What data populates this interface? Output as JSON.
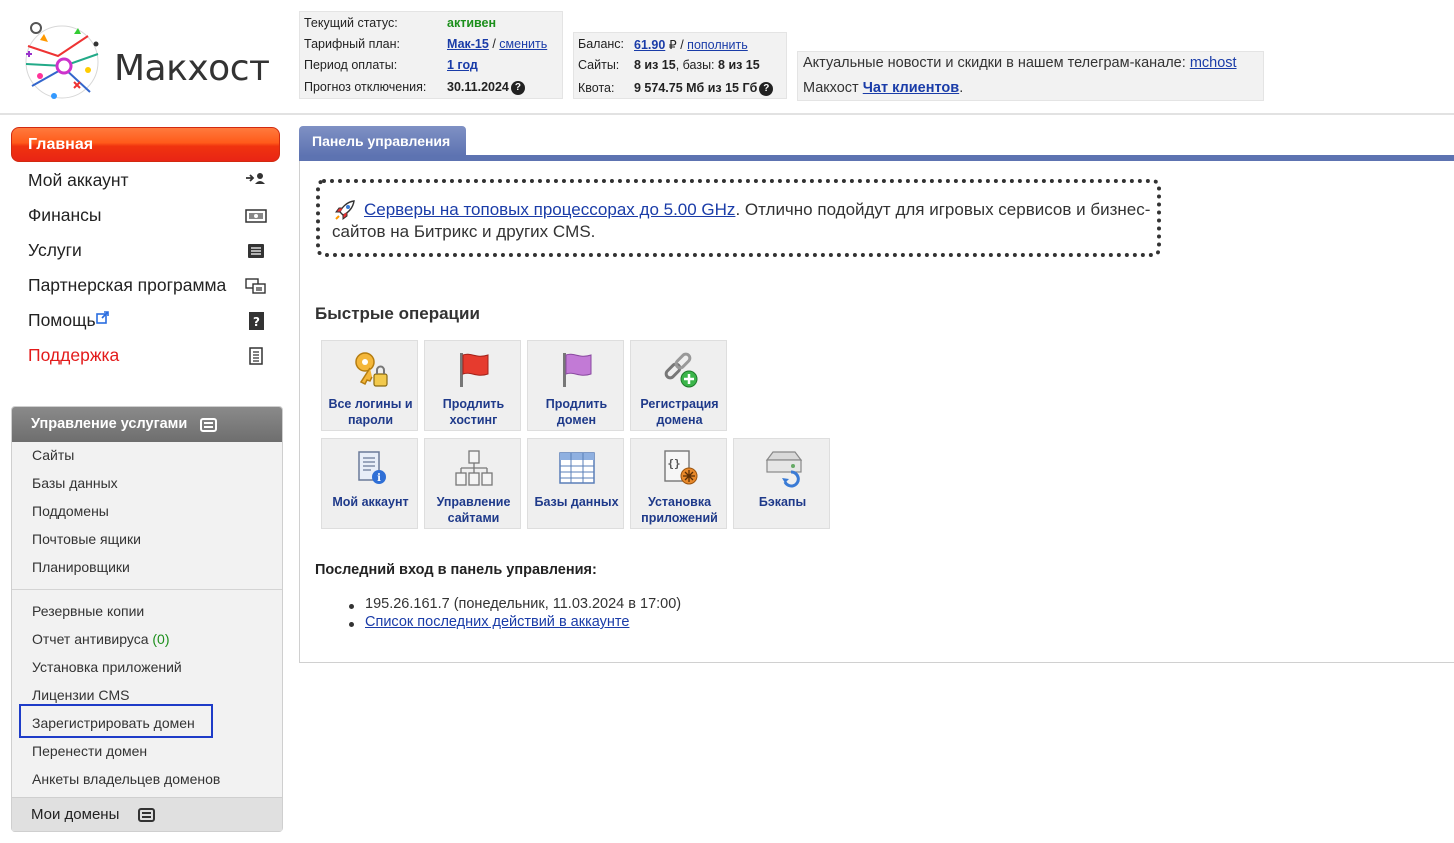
{
  "brand": {
    "name": "Макхост"
  },
  "status": {
    "current_status_label": "Текущий статус:",
    "current_status_value": "активен",
    "plan_label": "Тарифный план:",
    "plan_value": "Мак-15",
    "plan_sep": "/",
    "plan_change": "сменить",
    "period_label": "Период оплаты:",
    "period_value": "1 год",
    "forecast_label": "Прогноз отключения:",
    "forecast_value": "30.11.2024"
  },
  "account": {
    "balance_label": "Баланс:",
    "balance_value": "61.90",
    "currency": "₽",
    "balance_sep": "/",
    "topup": "пополнить",
    "sites_label": "Сайты:",
    "sites_value": "8 из 15",
    "db_label": ", базы:",
    "db_value": "8 из 15",
    "quota_label": "Квота:",
    "quota_value": "9 574.75 Мб из 15 Гб"
  },
  "news": {
    "line1": "Актуальные новости и скидки в нашем телеграм-канале:",
    "telegram": "mchost",
    "line2_prefix": "Макхост",
    "chat": "Чат клиентов",
    "line2_suffix": "."
  },
  "nav": {
    "main": "Главная",
    "items": [
      {
        "label": "Мой аккаунт",
        "icon": "user-switch-icon"
      },
      {
        "label": "Финансы",
        "icon": "money-icon"
      },
      {
        "label": "Услуги",
        "icon": "list-icon"
      },
      {
        "label": "Партнерская программа",
        "icon": "partner-icon"
      },
      {
        "label": "Помощь",
        "icon": "help-book-icon"
      },
      {
        "label": "Поддержка",
        "icon": "support-icon"
      }
    ]
  },
  "services": {
    "title": "Управление услугами",
    "group1": [
      "Сайты",
      "Базы данных",
      "Поддомены",
      "Почтовые ящики",
      "Планировщики"
    ],
    "group2": [
      "Резервные копии",
      "Отчет антивируса",
      "Установка приложений",
      "Лицензии CMS",
      "Зарегистрировать домен",
      "Перенести домен",
      "Анкеты владельцев доменов"
    ],
    "antivirus_count": "(0)",
    "footer": "Мои домены"
  },
  "main": {
    "tab": "Панель управления",
    "promo_link": "Серверы на топовых процессорах до 5.00 GHz",
    "promo_text": ". Отлично подойдут для игровых сервисов и бизнес-сайтов на Битрикс и других CMS.",
    "quick_title": "Быстрые операции",
    "tiles": [
      {
        "label": "Все логины и пароли",
        "icon": "keys-lock-icon"
      },
      {
        "label": "Продлить хостинг",
        "icon": "red-flag-icon"
      },
      {
        "label": "Продлить домен",
        "icon": "purple-flag-icon"
      },
      {
        "label": "Регистрация домена",
        "icon": "chain-add-icon"
      },
      {
        "label": "Мой аккаунт",
        "icon": "account-doc-icon"
      },
      {
        "label": "Управление сайтами",
        "icon": "sitemap-icon"
      },
      {
        "label": "Базы данных",
        "icon": "table-icon"
      },
      {
        "label": "Установка приложений",
        "icon": "app-install-icon"
      },
      {
        "label": "Бэкапы",
        "icon": "backup-drive-icon"
      }
    ],
    "last_login_title": "Последний вход в панель управления:",
    "last_login": "195.26.161.7 (понедельник, 11.03.2024 в 17:00)",
    "recent_actions": "Список последних действий в аккаунте"
  },
  "colors": {
    "accent": "#5d73b1",
    "main_button": "#f0330f",
    "highlight": "#1e3cc8",
    "link": "#1a3ca8"
  }
}
